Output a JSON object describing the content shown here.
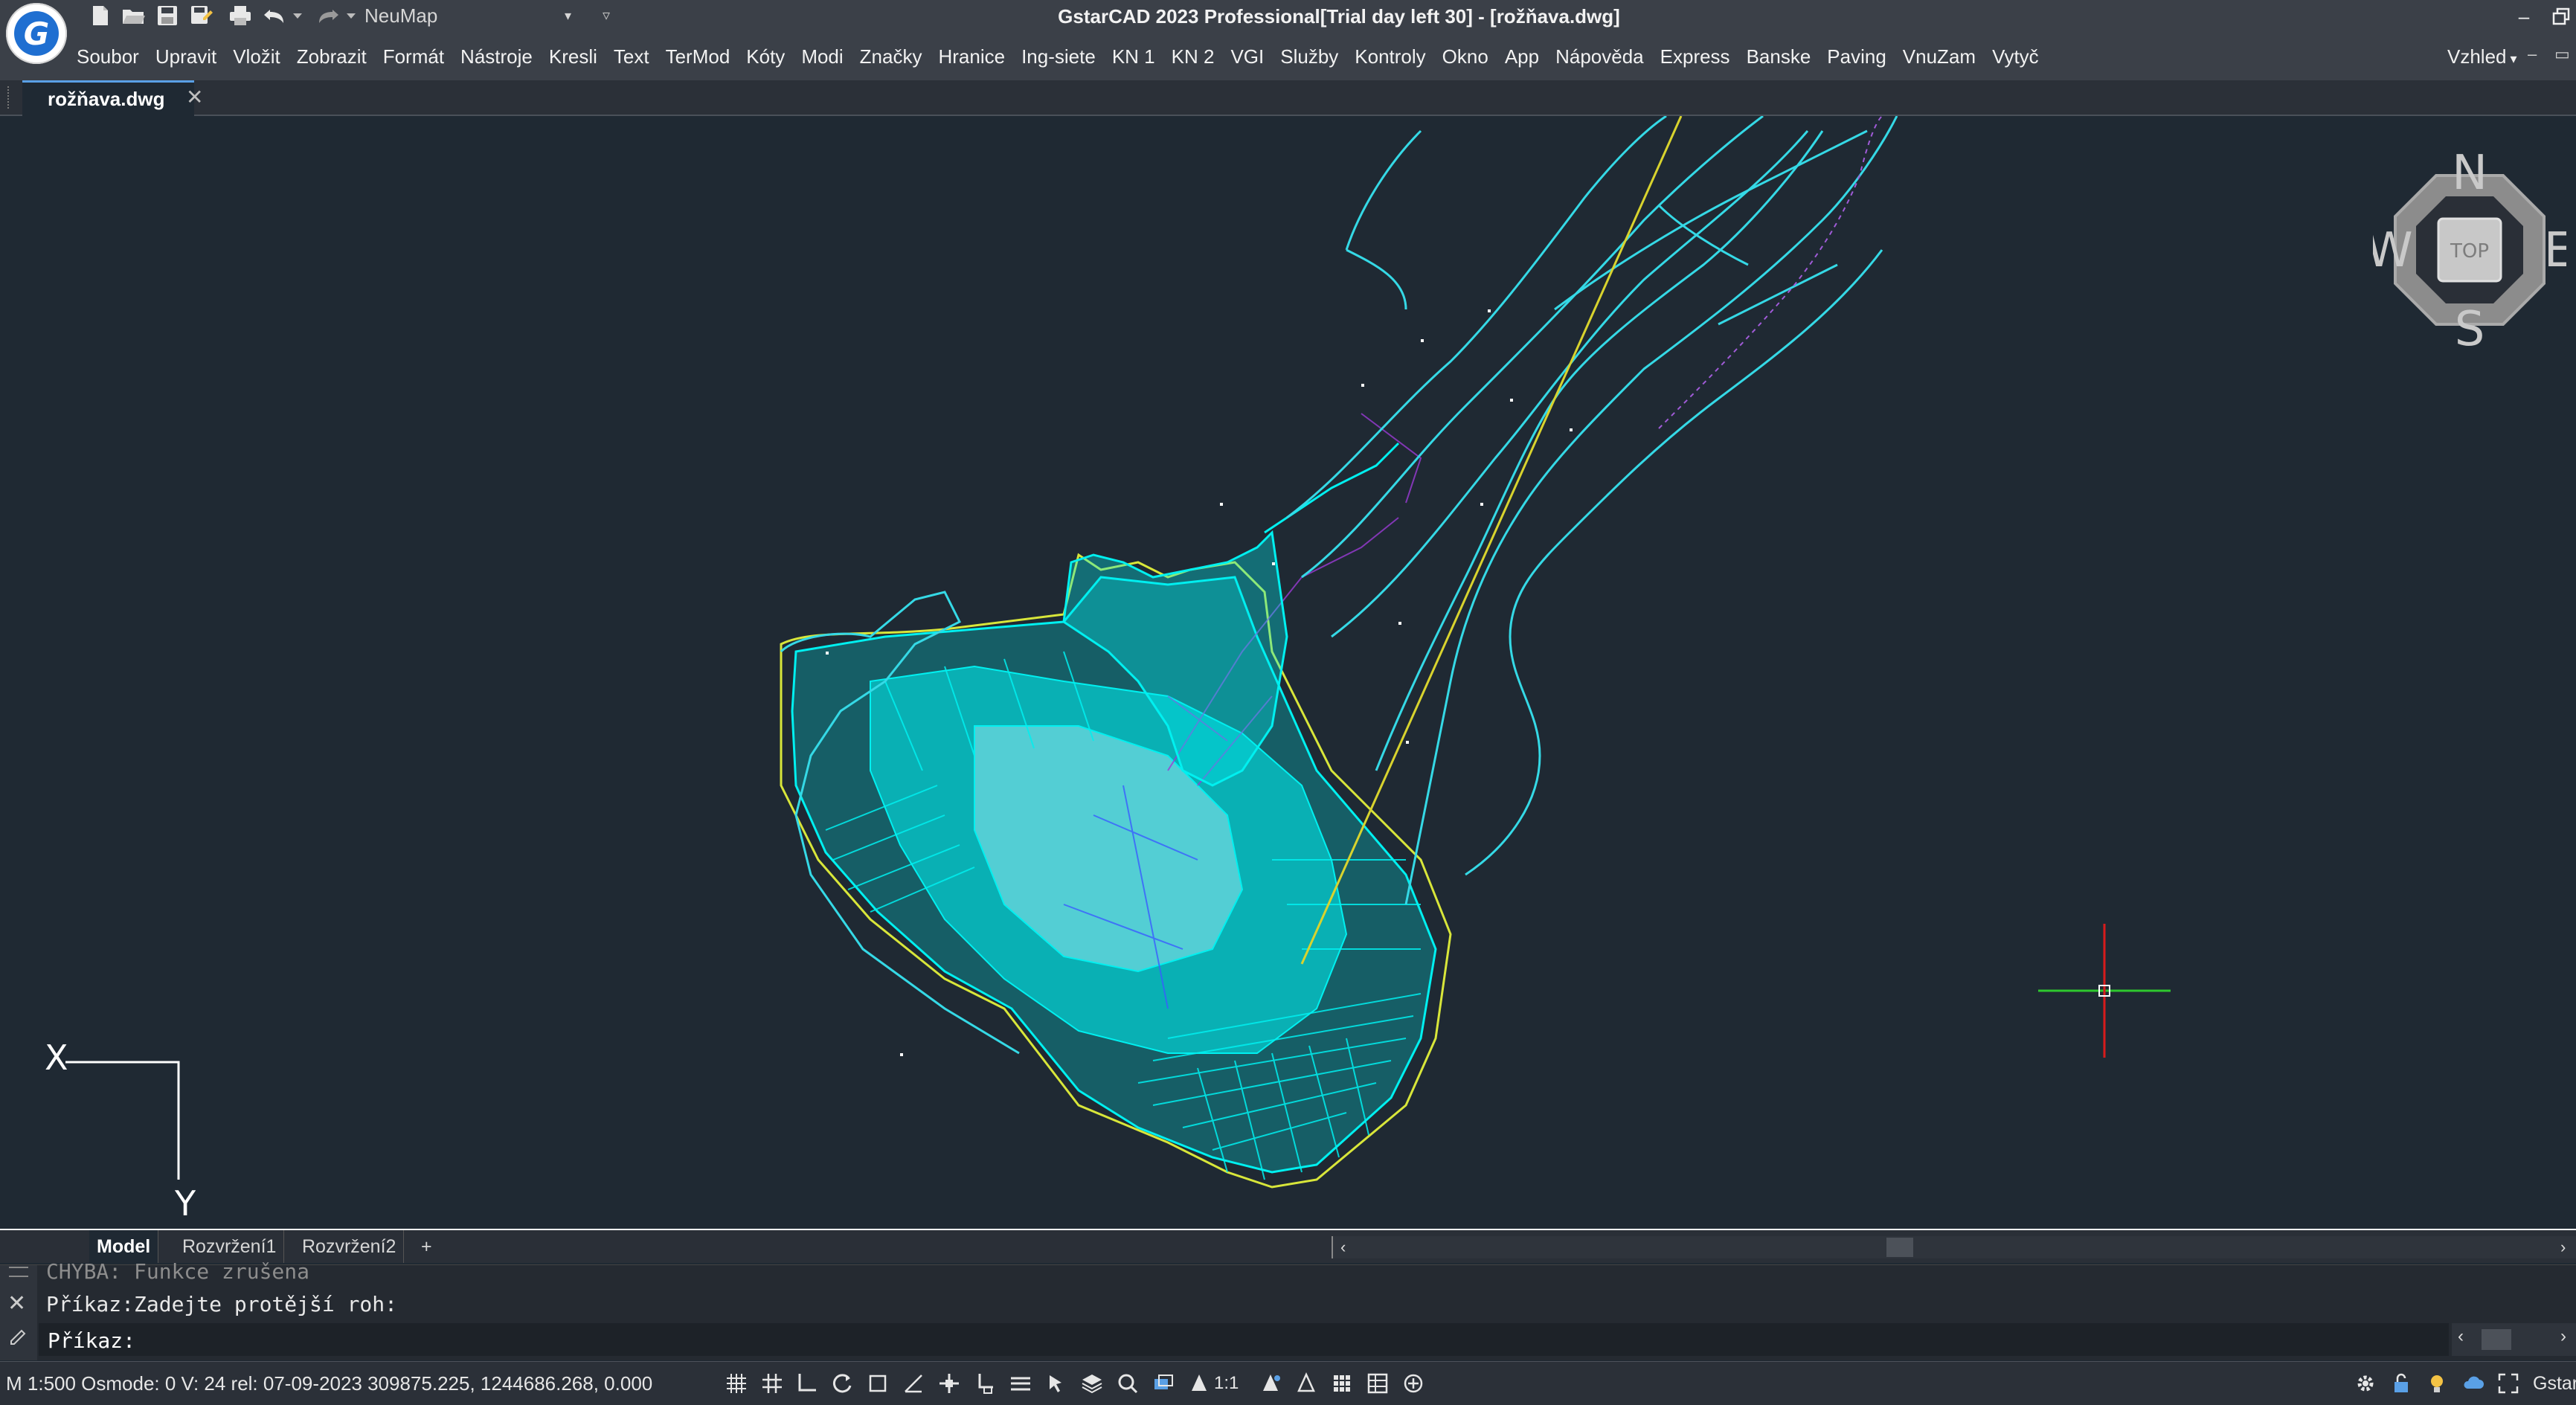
{
  "app": {
    "logo_letter": "G",
    "title": "GstarCAD 2023 Professional[Trial day left 30] - [rožňava.dwg]",
    "workspace": "NeuMap",
    "icons": [
      "new-file-icon",
      "open-folder-icon",
      "save-icon",
      "save-as-icon",
      "print-icon",
      "undo-icon",
      "redo-icon"
    ]
  },
  "menu": {
    "items": [
      "Soubor",
      "Upravit",
      "Vložit",
      "Zobrazit",
      "Formát",
      "Nástroje",
      "Kresli",
      "Text",
      "TerMod",
      "Kóty",
      "Modi",
      "Značky",
      "Hranice",
      "Ing-siete",
      "KN 1",
      "KN 2",
      "VGI",
      "Služby",
      "Kontroly",
      "Okno",
      "App",
      "Nápověda",
      "Express",
      "Banske",
      "Paving",
      "VnuZam",
      "Vytyč"
    ],
    "right_label": "Vzhled"
  },
  "document_tab": {
    "label": "rožňava.dwg"
  },
  "viewcube": {
    "north": "N",
    "south": "S",
    "east": "E",
    "west": "W",
    "face": "TOP"
  },
  "ucs": {
    "x_label": "X",
    "y_label": "Y"
  },
  "layout_tabs": {
    "model": "Model",
    "layout1": "Rozvržení1",
    "layout2": "Rozvržení2",
    "add": "+"
  },
  "command_line": {
    "history_faded": "CHYBA: Funkce zrušena",
    "history_last": "Příkaz:Zadejte protější roh:",
    "prompt": "Příkaz:"
  },
  "status_bar": {
    "text": "M 1:500 Osmode: 0 V: 24 rel: 07-09-2023  309875.225, 1244686.268, 0.000",
    "scale": "1:1",
    "right_text": "Gstar"
  },
  "colors": {
    "background": "#1f2933",
    "parcel_lines": "#00f0f0",
    "boundary": "#d8e63a",
    "contours": "#35d9e6",
    "crosshair_x": "#2ec82e",
    "crosshair_y": "#d81b1b"
  }
}
